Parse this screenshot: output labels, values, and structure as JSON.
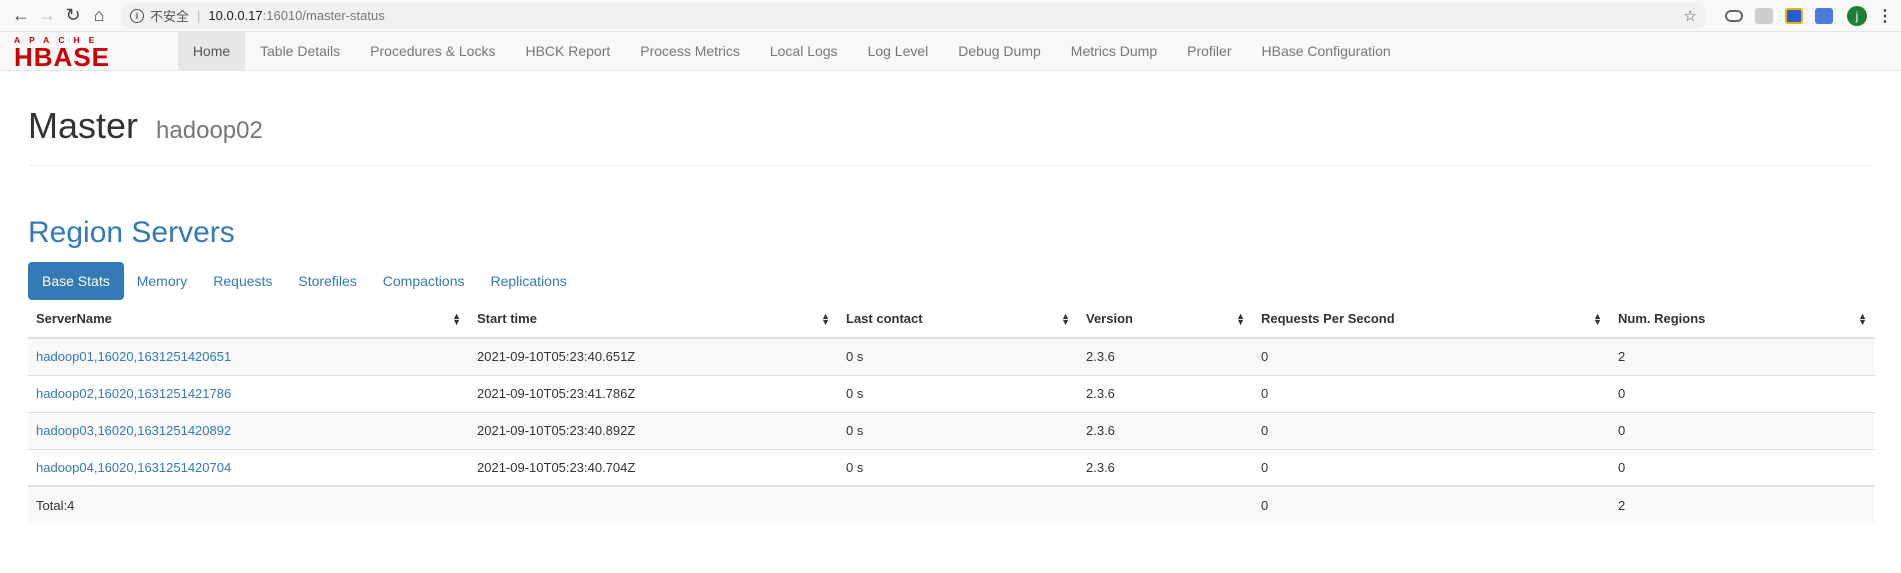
{
  "browser": {
    "insecure_label": "不安全",
    "url_host": "10.0.0.17",
    "url_path": ":16010/master-status",
    "profile_initial": "j"
  },
  "logo": {
    "top": "APACHE",
    "main": "HBASE"
  },
  "nav": [
    "Home",
    "Table Details",
    "Procedures & Locks",
    "HBCK Report",
    "Process Metrics",
    "Local Logs",
    "Log Level",
    "Debug Dump",
    "Metrics Dump",
    "Profiler",
    "HBase Configuration"
  ],
  "page": {
    "title": "Master",
    "host": "hadoop02"
  },
  "region_servers": {
    "heading": "Region Servers",
    "tabs": [
      "Base Stats",
      "Memory",
      "Requests",
      "Storefiles",
      "Compactions",
      "Replications"
    ],
    "columns": [
      "ServerName",
      "Start time",
      "Last contact",
      "Version",
      "Requests Per Second",
      "Num. Regions"
    ],
    "rows": [
      [
        "hadoop01,16020,1631251420651",
        "2021-09-10T05:23:40.651Z",
        "0 s",
        "2.3.6",
        "0",
        "2"
      ],
      [
        "hadoop02,16020,1631251421786",
        "2021-09-10T05:23:41.786Z",
        "0 s",
        "2.3.6",
        "0",
        "0"
      ],
      [
        "hadoop03,16020,1631251420892",
        "2021-09-10T05:23:40.892Z",
        "0 s",
        "2.3.6",
        "0",
        "0"
      ],
      [
        "hadoop04,16020,1631251420704",
        "2021-09-10T05:23:40.704Z",
        "0 s",
        "2.3.6",
        "0",
        "0"
      ]
    ],
    "total": {
      "label": "Total:4",
      "requests": "0",
      "regions": "2"
    }
  }
}
